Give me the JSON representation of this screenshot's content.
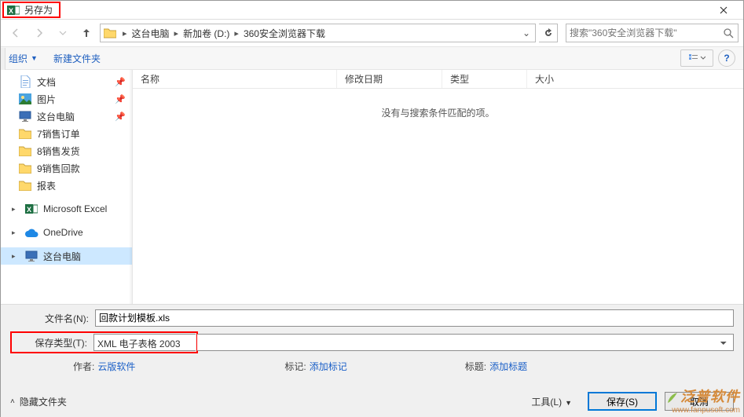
{
  "window": {
    "title": "另存为"
  },
  "breadcrumb": {
    "segs": [
      "这台电脑",
      "新加卷 (D:)",
      "360安全浏览器下载"
    ]
  },
  "search": {
    "placeholder": "搜索\"360安全浏览器下载\""
  },
  "toolbar": {
    "organize": "组织",
    "newfolder": "新建文件夹"
  },
  "columns": {
    "name": "名称",
    "date": "修改日期",
    "type": "类型",
    "size": "大小"
  },
  "empty_text": "没有与搜索条件匹配的项。",
  "sidebar": {
    "items": [
      {
        "label": "文档",
        "icon": "doc",
        "pinned": true
      },
      {
        "label": "图片",
        "icon": "pic",
        "pinned": true
      },
      {
        "label": "这台电脑",
        "icon": "pc",
        "pinned": true
      },
      {
        "label": "7销售订单",
        "icon": "folder"
      },
      {
        "label": "8销售发货",
        "icon": "folder"
      },
      {
        "label": "9销售回款",
        "icon": "folder"
      },
      {
        "label": "报表",
        "icon": "folder"
      }
    ],
    "middle": [
      {
        "label": "Microsoft Excel",
        "icon": "excel"
      }
    ],
    "lower": [
      {
        "label": "OneDrive",
        "icon": "onedrive"
      }
    ],
    "bottom": [
      {
        "label": "这台电脑",
        "icon": "pc",
        "selected": true
      }
    ]
  },
  "filename": {
    "label": "文件名(N):",
    "value": "回款计划模板.xls"
  },
  "filetype": {
    "label": "保存类型(T):",
    "value": "XML 电子表格 2003"
  },
  "meta": {
    "author_label": "作者:",
    "author_value": "云版软件",
    "tag_label": "标记:",
    "tag_value": "添加标记",
    "title_label": "标题:",
    "title_value": "添加标题"
  },
  "footer": {
    "hide": "隐藏文件夹",
    "tools": "工具(L)",
    "save": "保存(S)",
    "cancel": "取消"
  },
  "watermark": {
    "line1": "泛普软件",
    "line2": "www.fanpusoft.com"
  }
}
